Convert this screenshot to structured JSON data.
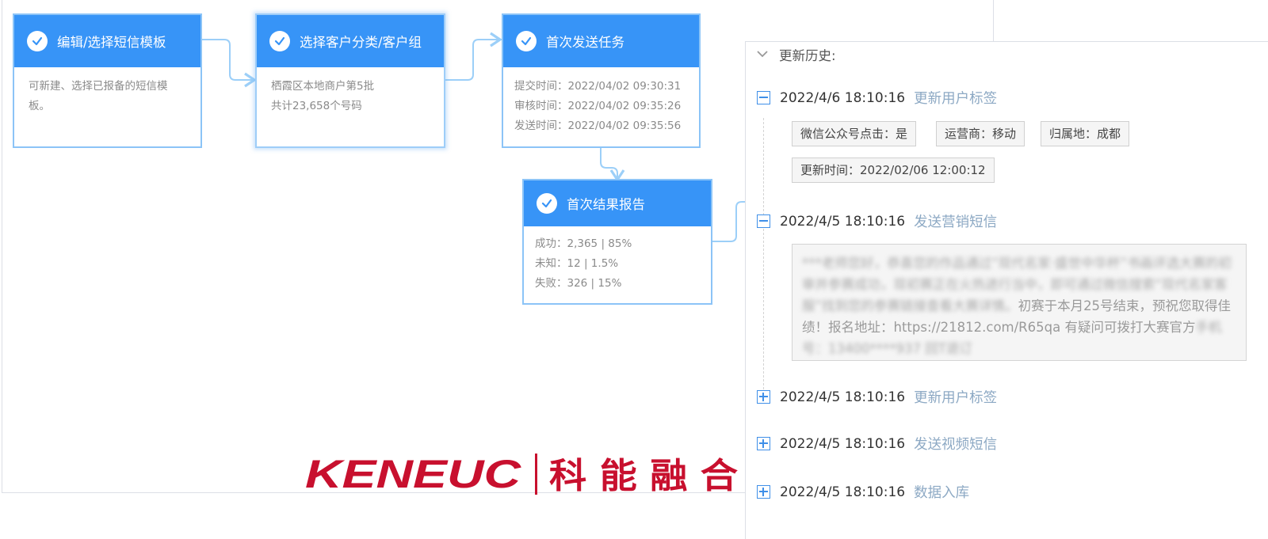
{
  "flow": {
    "cards": [
      {
        "title": "编辑/选择短信模板",
        "lines": [
          "可新建、选择已报备的短信模",
          "板。"
        ]
      },
      {
        "title": "选择客户分类/客户组",
        "lines": [
          "栖霞区本地商户第5批",
          "共计23,658个号码"
        ]
      },
      {
        "title": "首次发送任务",
        "lines": [
          "提交时间：2022/04/02  09:30:31",
          "审核时间：2022/04/02  09:35:26",
          "发送时间：2022/04/02  09:35:56"
        ]
      },
      {
        "title": "首次结果报告",
        "lines": [
          "成功：2,365 | 85%",
          "未知：12 | 1.5%",
          "失败：326 | 15%"
        ]
      }
    ]
  },
  "logo": {
    "brand": "KENEUC",
    "cn": "科 能 融 合",
    "color": "#c8102e"
  },
  "history": {
    "title": "更新历史:",
    "entries": [
      {
        "time": "2022/4/6 18:10:16",
        "type": "更新用户标签",
        "expanded": true,
        "tags": [
          "微信公众号点击：是",
          "运营商：移动",
          "归属地：成都",
          "更新时间：2022/02/06 12:00:12"
        ]
      },
      {
        "time": "2022/4/5 18:10:16",
        "type": "发送营销短信",
        "expanded": true,
        "message_blur": "***老师您好，恭喜您的作品通过“现代名家·盛世中华杯”书画评选大赛的初审并参赛成功，现初赛正在火热进行当中，即可通过微信搜索“现代名家客服”找到您的参赛链接查看大赛详情。",
        "message": "初赛于本月25号结束，预祝您取得佳绩！报名地址：https://21812.com/R65qa 有疑问可拨打大赛官方",
        "message_tail_blur": "手机号：13400****937 回T退订"
      },
      {
        "time": "2022/4/5 18:10:16",
        "type": "更新用户标签",
        "expanded": false
      },
      {
        "time": "2022/4/5 18:10:16",
        "type": "发送视频短信",
        "expanded": false
      },
      {
        "time": "2022/4/5 18:10:16",
        "type": "数据入库",
        "expanded": false
      }
    ]
  },
  "colors": {
    "accent": "#3794f7",
    "border": "#8cc4f7",
    "link": "#8da9c4"
  }
}
